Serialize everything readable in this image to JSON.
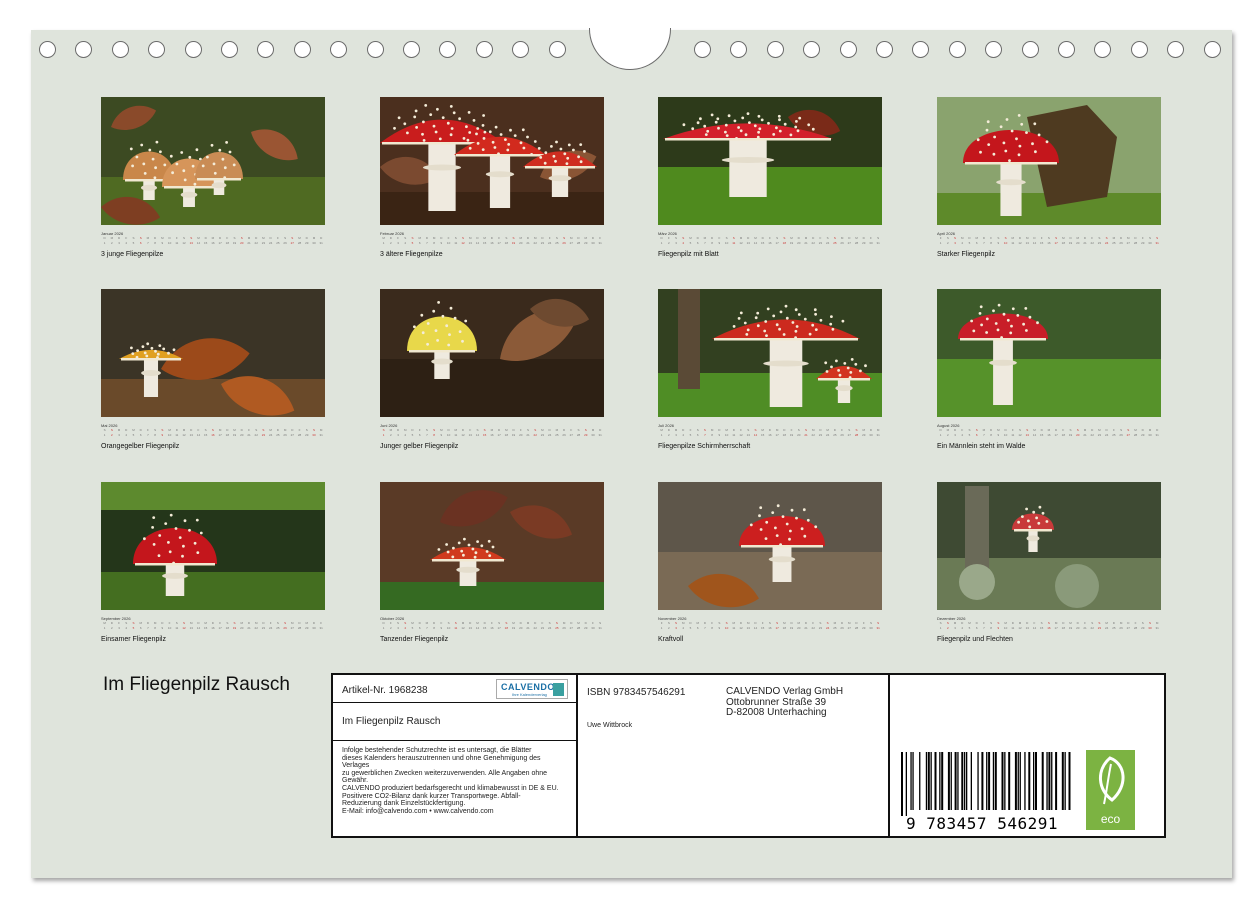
{
  "months": [
    {
      "name": "Januar 2026",
      "caption": "3 junge Fliegenpilze",
      "scene": "leaves-trio"
    },
    {
      "name": "Februar 2026",
      "caption": "3 ältere Fliegenpilze",
      "scene": "three-caps"
    },
    {
      "name": "März 2026",
      "caption": "Fliegenpilz mit Blatt",
      "scene": "flat-cap"
    },
    {
      "name": "April 2026",
      "caption": "Starker Fliegenpilz",
      "scene": "strong"
    },
    {
      "name": "Mai 2026",
      "caption": "Orangegelber Fliegenpilz",
      "scene": "orange"
    },
    {
      "name": "Juni 2026",
      "caption": "Junger gelber Fliegenpilz",
      "scene": "yellow"
    },
    {
      "name": "Juli 2026",
      "caption": "Fliegenpilze Schirmherrschaft",
      "scene": "umbrella"
    },
    {
      "name": "August 2026",
      "caption": "Ein Männlein steht im Walde",
      "scene": "maennlein"
    },
    {
      "name": "September 2026",
      "caption": "Einsamer Fliegenpilz",
      "scene": "lonely"
    },
    {
      "name": "Oktober 2026",
      "caption": "Tanzender Fliegenpilz",
      "scene": "dancing"
    },
    {
      "name": "November 2026",
      "caption": "Kraftvoll",
      "scene": "kraftvoll"
    },
    {
      "name": "Dezember 2026",
      "caption": "Fliegenpilz und Flechten",
      "scene": "lichen"
    }
  ],
  "cover_title": "Im Fliegenpilz Rausch",
  "info": {
    "article": "Artikel-Nr. 1968238",
    "logo_text": "CALVENDO",
    "logo_sub": "Ihre Kalenderverlag",
    "title": "Im Fliegenpilz Rausch",
    "legal": [
      "Infolge bestehender Schutzrechte ist es untersagt, die Blätter",
      "dieses Kalenders herauszutrennen und ohne Genehmigung des Verlages",
      "zu gewerblichen Zwecken weiterzuverwenden. Alle Angaben ohne",
      "Gewähr.",
      "CALVENDO produziert bedarfsgerecht und klimabewusst in DE & EU.",
      "Positivere CO2-Bilanz dank kurzer Transportwege. Abfall-",
      "Reduzierung dank Einzelstückfertigung.",
      "E-Mail: info@calvendo.com • www.calvendo.com"
    ],
    "isbn": "ISBN 9783457546291",
    "author": "Uwe Wittbrock",
    "publisher": [
      "CALVENDO Verlag GmbH",
      "Ottobrunner Straße 39",
      "D-82008 Unterhaching"
    ],
    "barcode_number": "9 783457 546291",
    "eco_label": "eco"
  },
  "colors": {
    "sheet": "#dfe4dc",
    "cap_red": "#c4161c",
    "moss": "#4e7d23"
  }
}
